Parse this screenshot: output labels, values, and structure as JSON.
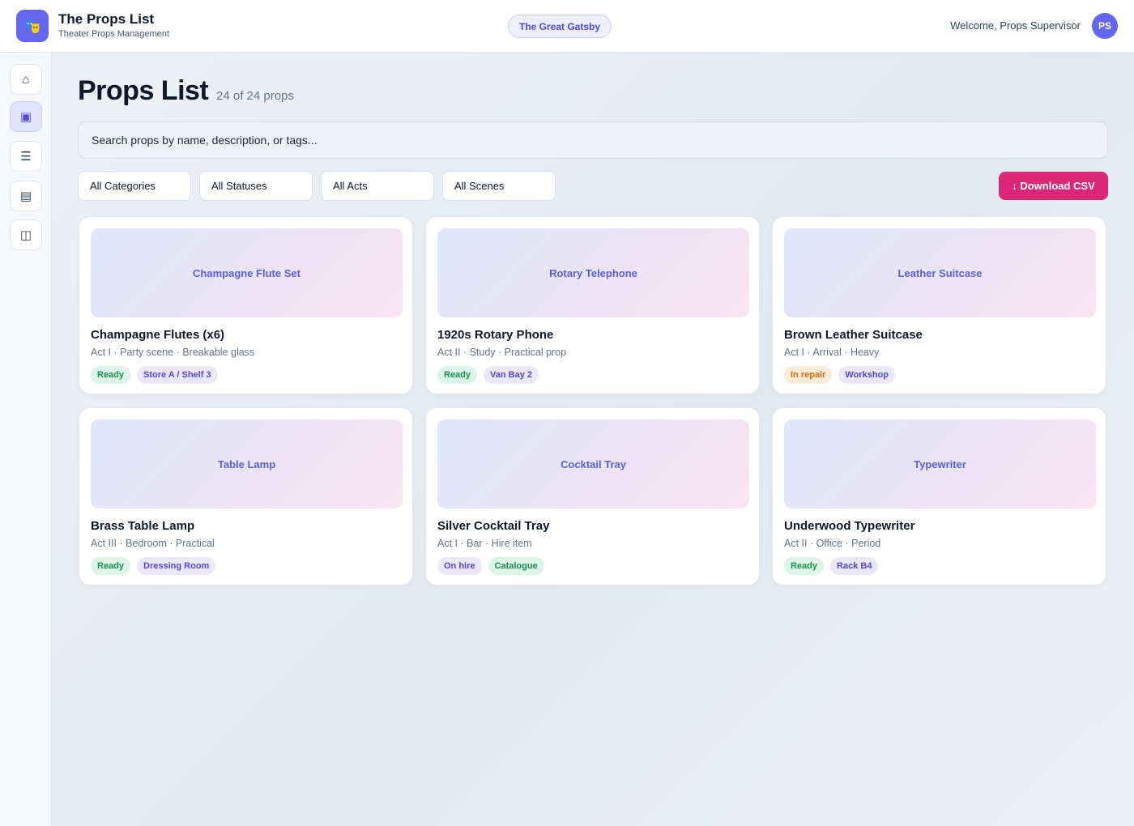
{
  "header": {
    "brand_title": "The Props List",
    "brand_subtitle": "Theater Props Management",
    "show_name": "The Great Gatsby",
    "welcome": "Welcome, Props Supervisor",
    "avatar_initials": "PS",
    "logo_icon": "theater-masks-icon"
  },
  "sidebar": {
    "items": [
      {
        "icon": "home-icon",
        "glyph": "⌂",
        "active": false
      },
      {
        "icon": "grid-icon",
        "glyph": "▣",
        "active": true
      },
      {
        "icon": "list-icon",
        "glyph": "☰",
        "active": false
      },
      {
        "icon": "table-icon",
        "glyph": "▤",
        "active": false
      },
      {
        "icon": "columns-icon",
        "glyph": "◫",
        "active": false
      }
    ]
  },
  "main": {
    "title": "Props List",
    "count": "24 of 24 props",
    "search_placeholder": "Search props by name, description, or tags...",
    "filters": [
      "All Categories",
      "All Statuses",
      "All Acts",
      "All Scenes"
    ],
    "download_label": "↓ Download CSV"
  },
  "cards": [
    {
      "image_label": "Champagne Flute Set",
      "title": "Champagne Flutes (x6)",
      "meta": "Act I · Party scene · Breakable glass",
      "tags": [
        {
          "text": "Ready",
          "color": "green"
        },
        {
          "text": "Store A / Shelf 3",
          "color": "purple"
        }
      ]
    },
    {
      "image_label": "Rotary Telephone",
      "title": "1920s Rotary Phone",
      "meta": "Act II · Study · Practical prop",
      "tags": [
        {
          "text": "Ready",
          "color": "green"
        },
        {
          "text": "Van Bay 2",
          "color": "purple"
        }
      ]
    },
    {
      "image_label": "Leather Suitcase",
      "title": "Brown Leather Suitcase",
      "meta": "Act I · Arrival · Heavy",
      "tags": [
        {
          "text": "In repair",
          "color": "orange"
        },
        {
          "text": "Workshop",
          "color": "purple"
        }
      ]
    },
    {
      "image_label": "Table Lamp",
      "title": "Brass Table Lamp",
      "meta": "Act III · Bedroom · Practical",
      "tags": [
        {
          "text": "Ready",
          "color": "green"
        },
        {
          "text": "Dressing Room",
          "color": "purple"
        }
      ]
    },
    {
      "image_label": "Cocktail Tray",
      "title": "Silver Cocktail Tray",
      "meta": "Act I · Bar · Hire item",
      "tags": [
        {
          "text": "On hire",
          "color": "purple"
        },
        {
          "text": "Catalogue",
          "color": "green"
        }
      ]
    },
    {
      "image_label": "Typewriter",
      "title": "Underwood Typewriter",
      "meta": "Act II · Office · Period",
      "tags": [
        {
          "text": "Ready",
          "color": "green"
        },
        {
          "text": "Rack B4",
          "color": "purple"
        }
      ]
    }
  ],
  "colors": {
    "accent": "#6366f1",
    "download": "#db2777",
    "ready": "#15904d",
    "repair": "#d06b10"
  }
}
